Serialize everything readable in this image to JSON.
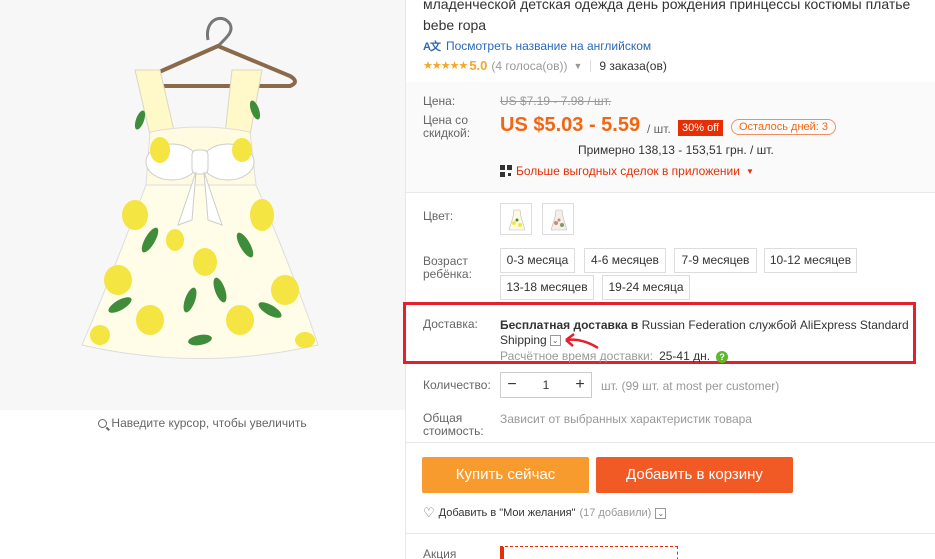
{
  "product": {
    "title": "младенческой детская одежда день рождения принцессы костюмы платье bebe ropa",
    "translate_link": "Посмотреть название на английском",
    "rating": {
      "stars": "★★★★★",
      "value": "5.0",
      "votes": "(4 голоса(ов))",
      "orders": "9 заказа(ов)"
    }
  },
  "price": {
    "price_label": "Цена:",
    "old_price": "US $7.19 - 7.98 / шт.",
    "discount_label": "Цена со скидкой:",
    "new_price": "US $5.03 - 5.59",
    "per_unit": "/ шт.",
    "discount_badge": "30% off",
    "days_left": "Осталось дней: 3",
    "approx": "Примерно 138,13 - 153,51 грн. / шт.",
    "app_deals": "Больше выгодных сделок в приложении"
  },
  "options": {
    "color_label": "Цвет:",
    "age_label": "Возраст ребёнка:",
    "ages": [
      "0-3 месяца",
      "4-6 месяцев",
      "7-9 месяцев",
      "10-12 месяцев",
      "13-18 месяцев",
      "19-24 месяца"
    ]
  },
  "shipping": {
    "label": "Доставка:",
    "free": "Бесплатная доставка в",
    "destination": "Russian Federation службой AliExpress Standard Shipping",
    "time_label": "Расчётное время доставки:",
    "time_value": "25-41 дн."
  },
  "quantity": {
    "label": "Количество:",
    "value": "1",
    "note": "шт. (99 шт. at most per customer)"
  },
  "total": {
    "label": "Общая стоимость:",
    "note": "Зависит от выбранных характеристик товара"
  },
  "actions": {
    "buy_now": "Купить сейчас",
    "add_to_cart": "Добавить в корзину",
    "wishlist": "Добавить в \"Мои желания\"",
    "wishlist_count": "(17 добавили)"
  },
  "promo": {
    "label": "Акция"
  },
  "zoom_hint": "Наведите курсор, чтобы увеличить",
  "colors": {
    "accent": "#f26611",
    "buy": "#f89b2e",
    "cart": "#f15a24",
    "highlight": "#e3202c",
    "link": "#2b69b6"
  }
}
